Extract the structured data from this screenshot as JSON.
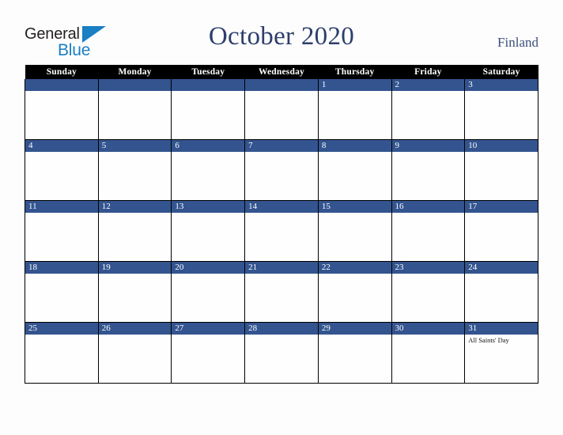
{
  "brand": {
    "word_one": "General",
    "word_two": "Blue",
    "triangle_color": "#1b7fc4",
    "text_color": "#231f20"
  },
  "header": {
    "title": "October 2020",
    "country": "Finland",
    "title_color": "#2c3e6b"
  },
  "calendar": {
    "header_bg": "#000000",
    "daybar_bg": "#33548f",
    "weekdays": [
      "Sunday",
      "Monday",
      "Tuesday",
      "Wednesday",
      "Thursday",
      "Friday",
      "Saturday"
    ],
    "weeks": [
      [
        {
          "day": "",
          "events": []
        },
        {
          "day": "",
          "events": []
        },
        {
          "day": "",
          "events": []
        },
        {
          "day": "",
          "events": []
        },
        {
          "day": "1",
          "events": []
        },
        {
          "day": "2",
          "events": []
        },
        {
          "day": "3",
          "events": []
        }
      ],
      [
        {
          "day": "4",
          "events": []
        },
        {
          "day": "5",
          "events": []
        },
        {
          "day": "6",
          "events": []
        },
        {
          "day": "7",
          "events": []
        },
        {
          "day": "8",
          "events": []
        },
        {
          "day": "9",
          "events": []
        },
        {
          "day": "10",
          "events": []
        }
      ],
      [
        {
          "day": "11",
          "events": []
        },
        {
          "day": "12",
          "events": []
        },
        {
          "day": "13",
          "events": []
        },
        {
          "day": "14",
          "events": []
        },
        {
          "day": "15",
          "events": []
        },
        {
          "day": "16",
          "events": []
        },
        {
          "day": "17",
          "events": []
        }
      ],
      [
        {
          "day": "18",
          "events": []
        },
        {
          "day": "19",
          "events": []
        },
        {
          "day": "20",
          "events": []
        },
        {
          "day": "21",
          "events": []
        },
        {
          "day": "22",
          "events": []
        },
        {
          "day": "23",
          "events": []
        },
        {
          "day": "24",
          "events": []
        }
      ],
      [
        {
          "day": "25",
          "events": []
        },
        {
          "day": "26",
          "events": []
        },
        {
          "day": "27",
          "events": []
        },
        {
          "day": "28",
          "events": []
        },
        {
          "day": "29",
          "events": []
        },
        {
          "day": "30",
          "events": []
        },
        {
          "day": "31",
          "events": [
            "All Saints' Day"
          ]
        }
      ]
    ]
  }
}
